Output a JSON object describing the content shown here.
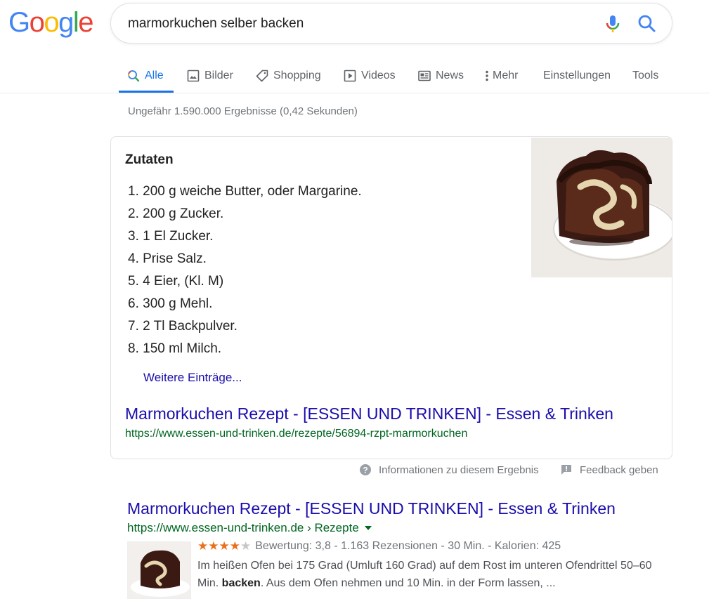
{
  "logo": {
    "letters": [
      "G",
      "o",
      "o",
      "g",
      "l",
      "e"
    ],
    "colors": [
      "#4285f4",
      "#ea4335",
      "#fbbc05",
      "#4285f4",
      "#34a853",
      "#ea4335"
    ]
  },
  "search": {
    "query": "marmorkuchen selber backen"
  },
  "tabs": [
    {
      "label": "Alle",
      "icon": "search-icon",
      "active": true
    },
    {
      "label": "Bilder",
      "icon": "image-icon"
    },
    {
      "label": "Shopping",
      "icon": "tag-icon"
    },
    {
      "label": "Videos",
      "icon": "play-icon"
    },
    {
      "label": "News",
      "icon": "newspaper-icon"
    },
    {
      "label": "Mehr",
      "icon": "more-vert-icon"
    },
    {
      "label": "Einstellungen"
    },
    {
      "label": "Tools"
    }
  ],
  "stats": "Ungefähr 1.590.000 Ergebnisse (0,42 Sekunden)",
  "featured": {
    "title": "Zutaten",
    "ingredients": [
      "1. 200 g weiche Butter, oder Margarine.",
      "2. 200 g Zucker.",
      "3. 1 El Zucker.",
      "4. Prise Salz.",
      "5. 4 Eier, (Kl. M)",
      "6. 300 g Mehl.",
      "7. 2 Tl Backpulver.",
      "8. 150 ml Milch."
    ],
    "more_link": "Weitere Einträge...",
    "link_title": "Marmorkuchen Rezept - [ESSEN UND TRINKEN] - Essen & Trinken",
    "link_url": "https://www.essen-und-trinken.de/rezepte/56894-rzpt-marmorkuchen",
    "image": "marble-cake-photo"
  },
  "feedback": {
    "info_label": "Informationen zu diesem Ergebnis",
    "feedback_label": "Feedback geben"
  },
  "result": {
    "title": "Marmorkuchen Rezept - [ESSEN UND TRINKEN] - Essen & Trinken",
    "url": "https://www.essen-und-trinken.de › Rezepte",
    "rating_stars": 3.8,
    "rating_text": "Bewertung: 3,8 - 1.163 Rezensionen - 30 Min. - Kalorien: 425",
    "snippet_before": "Im heißen Ofen bei 175 Grad (Umluft 160 Grad) auf dem Rost im unteren Ofendrittel 50–60 Min. ",
    "snippet_bold": "backen",
    "snippet_after": ". Aus dem Ofen nehmen und 10 Min. in der Form lassen, ..."
  },
  "colors": {
    "link": "#1a0dab",
    "url": "#006621",
    "accent": "#1a73e8",
    "star": "#e7711b"
  }
}
